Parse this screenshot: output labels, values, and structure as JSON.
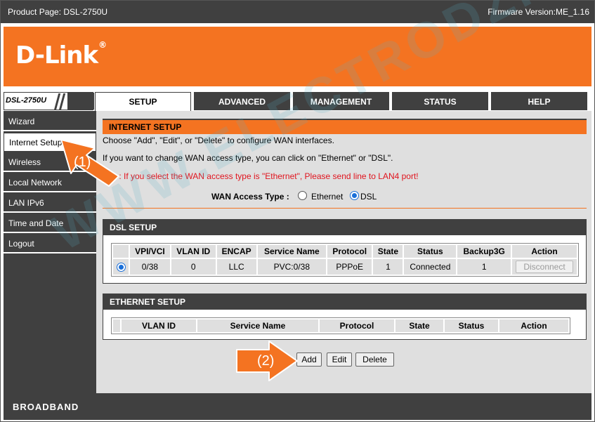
{
  "header": {
    "product_page": "Product Page: DSL-2750U",
    "firmware": "Firmware Version:ME_1.16"
  },
  "brand": {
    "logo": "D-Link",
    "registered": "®",
    "model": "DSL-2750U",
    "footer": "BROADBAND"
  },
  "nav_tabs": [
    {
      "label": "SETUP",
      "active": true
    },
    {
      "label": "ADVANCED",
      "active": false
    },
    {
      "label": "MANAGEMENT",
      "active": false
    },
    {
      "label": "STATUS",
      "active": false
    },
    {
      "label": "HELP",
      "active": false
    }
  ],
  "sidebar": {
    "items": [
      {
        "label": "Wizard",
        "active": false
      },
      {
        "label": "Internet Setup",
        "active": true
      },
      {
        "label": "Wireless",
        "active": false
      },
      {
        "label": "Local Network",
        "active": false
      },
      {
        "label": "LAN IPv6",
        "active": false
      },
      {
        "label": "Time and Date",
        "active": false
      },
      {
        "label": "Logout",
        "active": false
      }
    ]
  },
  "internet_setup": {
    "title": "INTERNET SETUP",
    "line1": "Choose \"Add\", \"Edit\", or \"Delete\" to configure WAN interfaces.",
    "line2": "If you want to change WAN access type, you can click on \"Ethernet\" or \"DSL\".",
    "line3": "te : If you select the WAN access type is \"Ethernet\", Please send line to LAN4 port!",
    "wan_label": "WAN Access Type :",
    "wan_options": [
      {
        "label": "Ethernet",
        "checked": false
      },
      {
        "label": "DSL",
        "checked": true
      }
    ]
  },
  "dsl_setup": {
    "title": "DSL SETUP",
    "columns": [
      "",
      "VPI/VCI",
      "VLAN ID",
      "ENCAP",
      "Service Name",
      "Protocol",
      "State",
      "Status",
      "Backup3G",
      "Action"
    ],
    "rows": [
      {
        "selected": true,
        "vpi_vci": "0/38",
        "vlan_id": "0",
        "encap": "LLC",
        "service_name": "PVC:0/38",
        "protocol": "PPPoE",
        "state": "1",
        "status": "Connected",
        "backup3g": "1",
        "action": "Disconnect"
      }
    ]
  },
  "ethernet_setup": {
    "title": "ETHERNET SETUP",
    "columns": [
      "",
      "VLAN ID",
      "Service Name",
      "Protocol",
      "State",
      "Status",
      "Action"
    ]
  },
  "buttons": {
    "add": "Add",
    "edit": "Edit",
    "delete": "Delete"
  },
  "annotations": {
    "one": "(1)",
    "two": "(2)"
  },
  "watermark": "WWW.ELECTRODZ.COM",
  "colors": {
    "accent": "#f47321",
    "dark": "#404040",
    "panel": "#dfdfdf",
    "warning": "#e0141e"
  }
}
